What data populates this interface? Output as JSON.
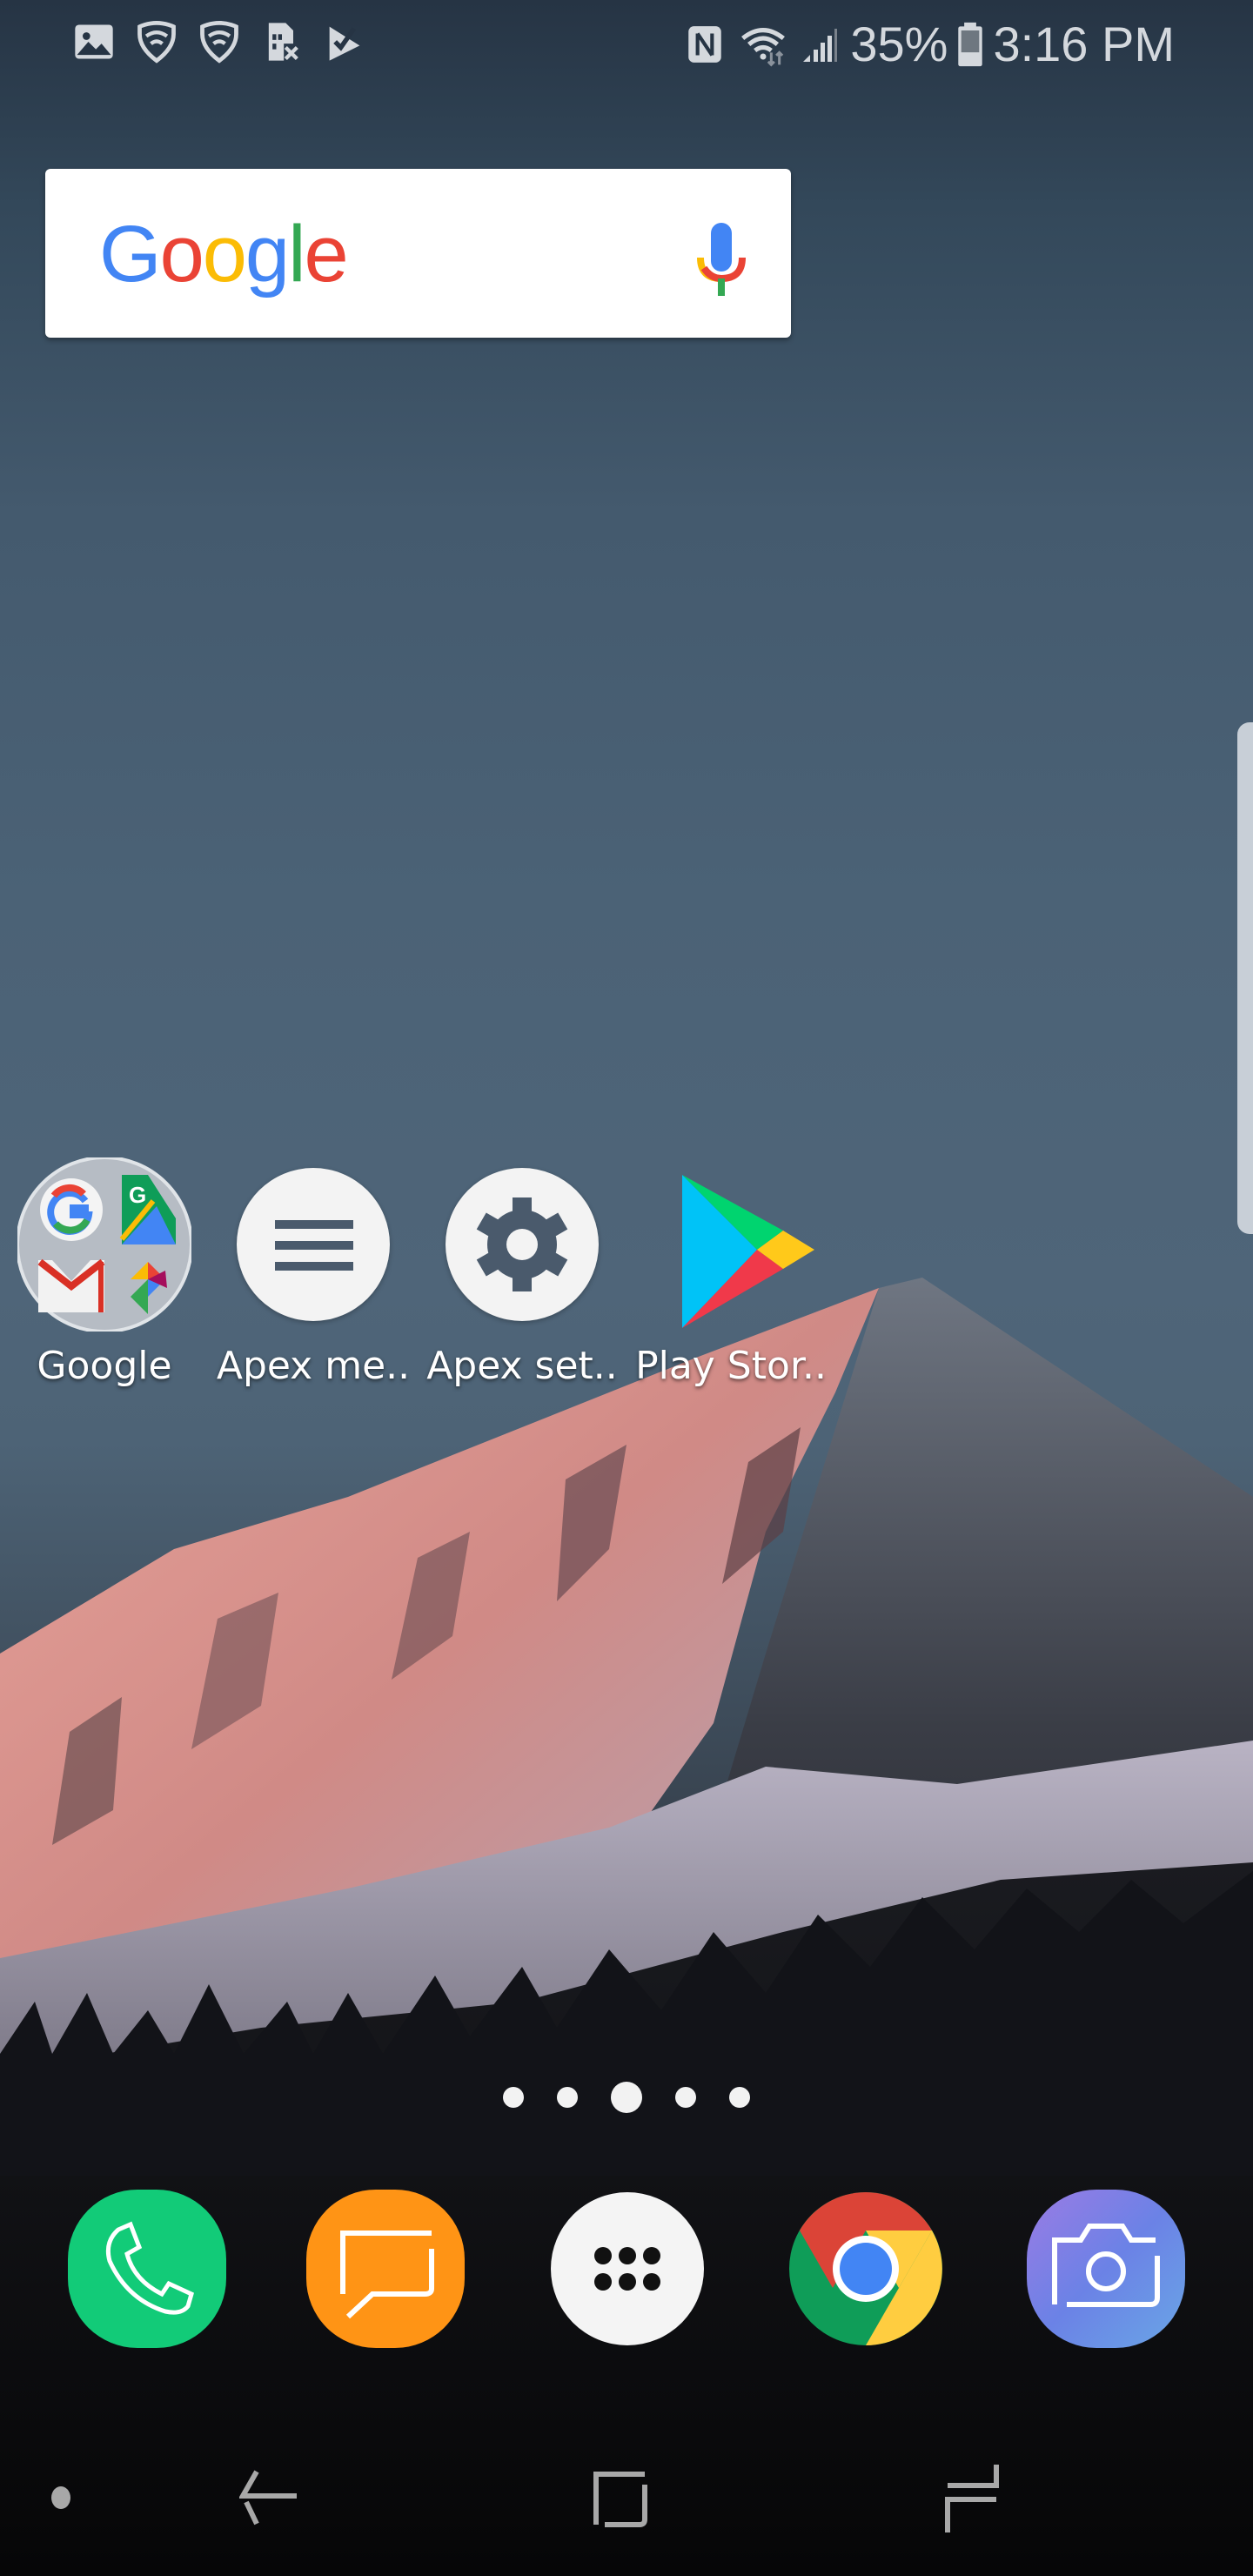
{
  "status_bar": {
    "left_icons": [
      "gallery-icon",
      "shield-wifi-icon",
      "shield-wifi-icon",
      "sim-card-error-icon",
      "checkmark-flag-icon"
    ],
    "right_icons": [
      "nfc-icon",
      "wifi-data-icon",
      "signal-strength-icon"
    ],
    "battery_percent": "35%",
    "battery_level": 0.35,
    "time": "3:16 PM"
  },
  "search_widget": {
    "logo_letters": [
      {
        "char": "G",
        "color": "#4285F4"
      },
      {
        "char": "o",
        "color": "#EA4335"
      },
      {
        "char": "o",
        "color": "#FBBC05"
      },
      {
        "char": "g",
        "color": "#4285F4"
      },
      {
        "char": "l",
        "color": "#34A853"
      },
      {
        "char": "e",
        "color": "#EA4335"
      }
    ],
    "mic_icon": "mic-icon"
  },
  "home_apps": [
    {
      "label": "Google",
      "icon": "google-folder-icon"
    },
    {
      "label": "Apex me..",
      "icon": "menu-icon"
    },
    {
      "label": "Apex set..",
      "icon": "gear-icon"
    },
    {
      "label": "Play Stor..",
      "icon": "play-store-icon"
    }
  ],
  "page_indicator": {
    "pages": 5,
    "active_page": 3
  },
  "dock": [
    {
      "name": "Phone",
      "icon": "phone-icon",
      "color": "#12CB78"
    },
    {
      "name": "Messages",
      "icon": "message-icon",
      "color": "#FF9415"
    },
    {
      "name": "Apps",
      "icon": "app-drawer-icon",
      "color": "#F4F4F4"
    },
    {
      "name": "Chrome",
      "icon": "chrome-icon",
      "color": "#4285F4"
    },
    {
      "name": "Camera",
      "icon": "camera-icon",
      "color": "#7B86E8"
    }
  ],
  "nav_bar": {
    "buttons": [
      "nav-dot",
      "back",
      "home",
      "recents"
    ]
  },
  "colors": {
    "status_icon": "#D4D8DD",
    "nav_icon": "#A8A8A8"
  }
}
